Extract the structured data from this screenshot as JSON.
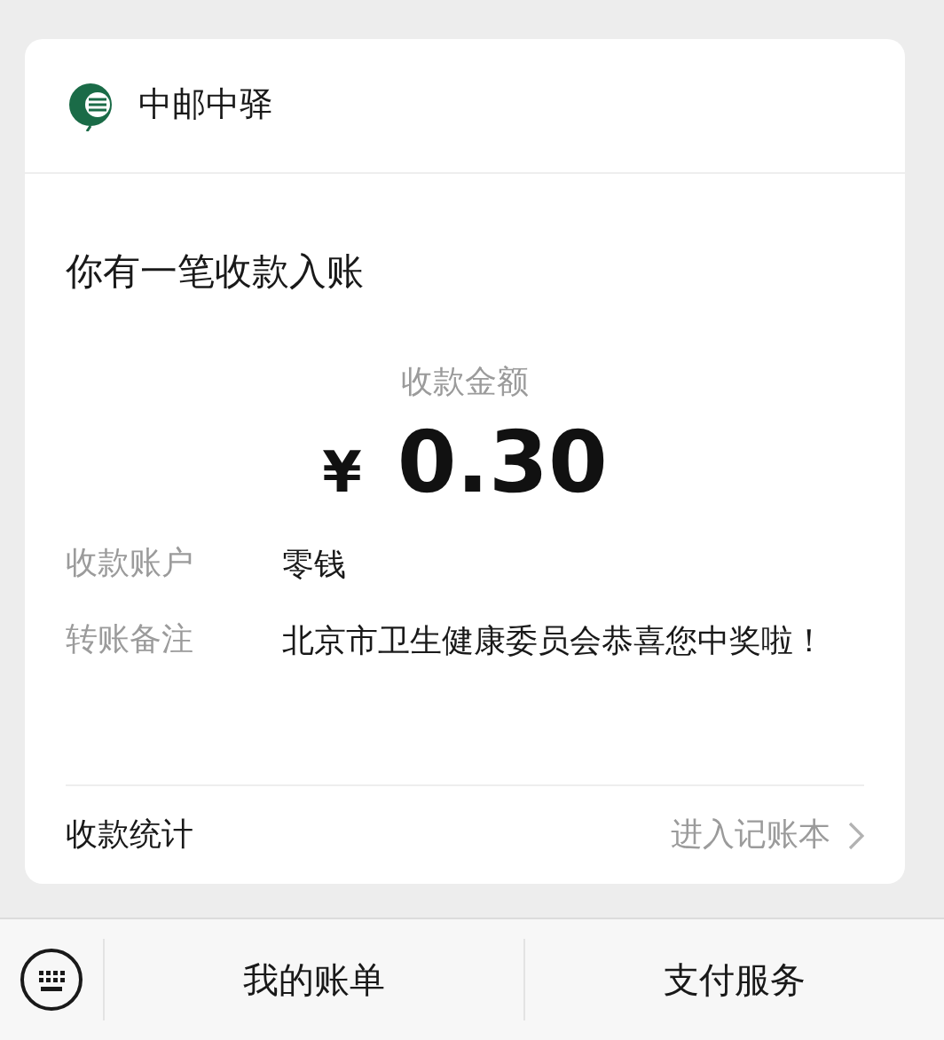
{
  "card": {
    "sender": "中邮中驿",
    "title": "你有一笔收款入账",
    "amount_label": "收款金额",
    "currency": "¥",
    "amount": "0.30",
    "details": [
      {
        "label": "收款账户",
        "value": "零钱"
      },
      {
        "label": "转账备注",
        "value": "北京市卫生健康委员会恭喜您中奖啦！"
      }
    ],
    "footer": {
      "label": "收款统计",
      "link": "进入记账本"
    }
  },
  "bottom_bar": {
    "menus": [
      "我的账单",
      "支付服务"
    ]
  }
}
